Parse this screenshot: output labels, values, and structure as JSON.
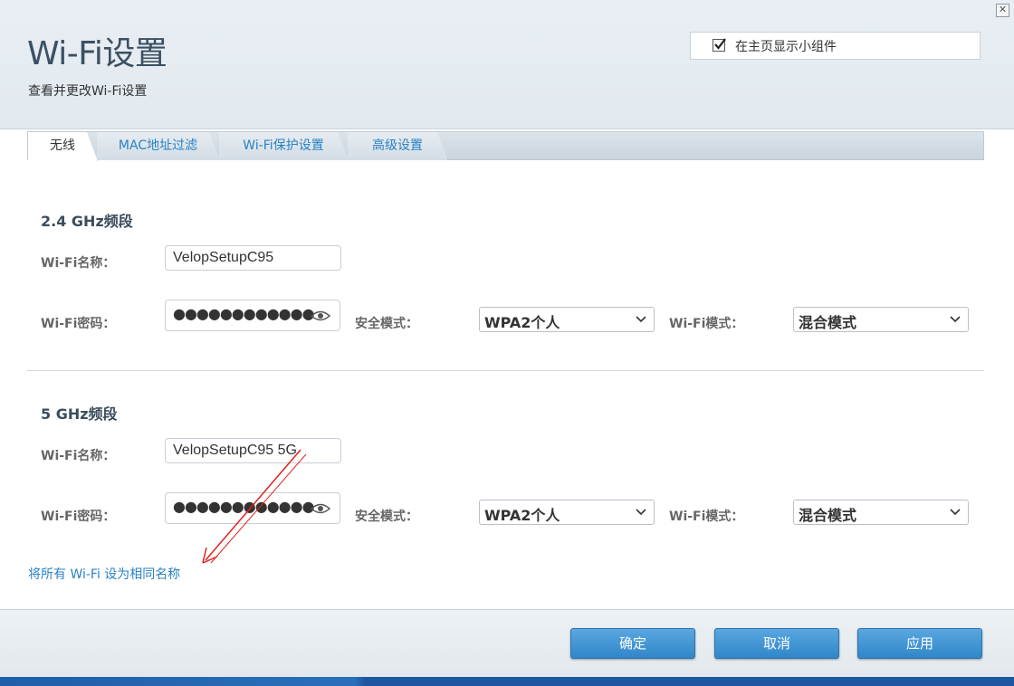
{
  "header": {
    "title": "Wi-Fi设置",
    "subtitle": "查看并更改Wi-Fi设置",
    "close_icon": "close-icon",
    "show_widget": {
      "label": "在主页显示小组件",
      "checked": true
    }
  },
  "tabs": [
    {
      "label": "无线",
      "active": true
    },
    {
      "label": "MAC地址过滤",
      "active": false
    },
    {
      "label": "Wi-Fi保护设置",
      "active": false
    },
    {
      "label": "高级设置",
      "active": false
    }
  ],
  "bands": [
    {
      "title": "2.4 GHz频段",
      "name_label": "Wi-Fi名称：",
      "name_value": "VelopSetupC95",
      "password_label": "Wi-Fi密码：",
      "password_mask": "●●●●●●●●●●●●",
      "security_label": "安全模式：",
      "security_value": "WPA2个人",
      "mode_label": "Wi-Fi模式：",
      "mode_value": "混合模式"
    },
    {
      "title": "5 GHz频段",
      "name_label": "Wi-Fi名称：",
      "name_value": "VelopSetupC95 5G",
      "password_label": "Wi-Fi密码：",
      "password_mask": "●●●●●●●●●●●●",
      "security_label": "安全模式：",
      "security_value": "WPA2个人",
      "mode_label": "Wi-Fi模式：",
      "mode_value": "混合模式"
    }
  ],
  "same_name_link": "将所有 Wi-Fi 设为相同名称",
  "footer": {
    "ok": "确定",
    "cancel": "取消",
    "apply": "应用"
  },
  "colors": {
    "accent": "#2b82c5",
    "button": "#3a8fd0",
    "annotation": "#e0201c"
  }
}
